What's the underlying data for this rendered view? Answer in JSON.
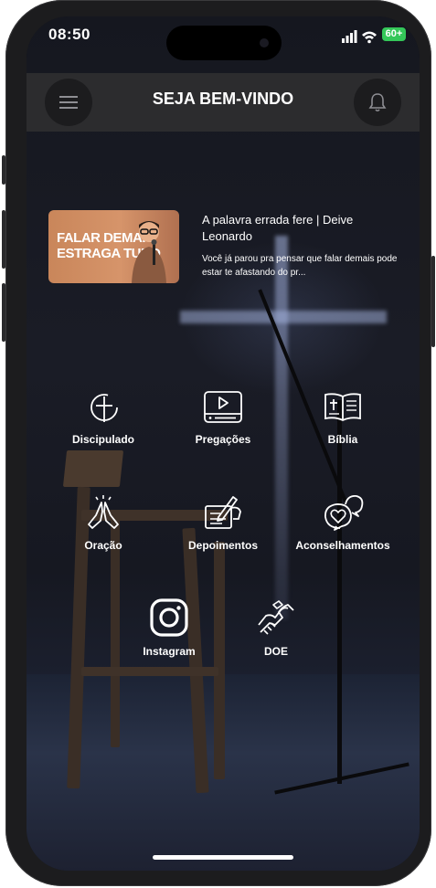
{
  "status_bar": {
    "time": "08:50",
    "battery": "60+"
  },
  "header": {
    "title": "SEJA BEM-VINDO",
    "menu_icon": "menu-icon",
    "notification_icon": "bell-icon"
  },
  "featured": {
    "thumbnail_text": "FALAR DEMAIS\nESTRAGA TUDO",
    "title": "A palavra errada fere | Deive Leonardo",
    "description": "Você já parou pra pensar que falar demais pode estar te afastando do pr..."
  },
  "menu": {
    "discipulado": "Discipulado",
    "pregacoes": "Pregações",
    "biblia": "Bíblia",
    "oracao": "Oração",
    "depoimentos": "Depoimentos",
    "aconselhamentos": "Aconselhamentos",
    "instagram": "Instagram",
    "doe": "DOE"
  },
  "colors": {
    "header_bg": "#2c2c2e",
    "battery": "#34c759",
    "text": "#ffffff"
  }
}
